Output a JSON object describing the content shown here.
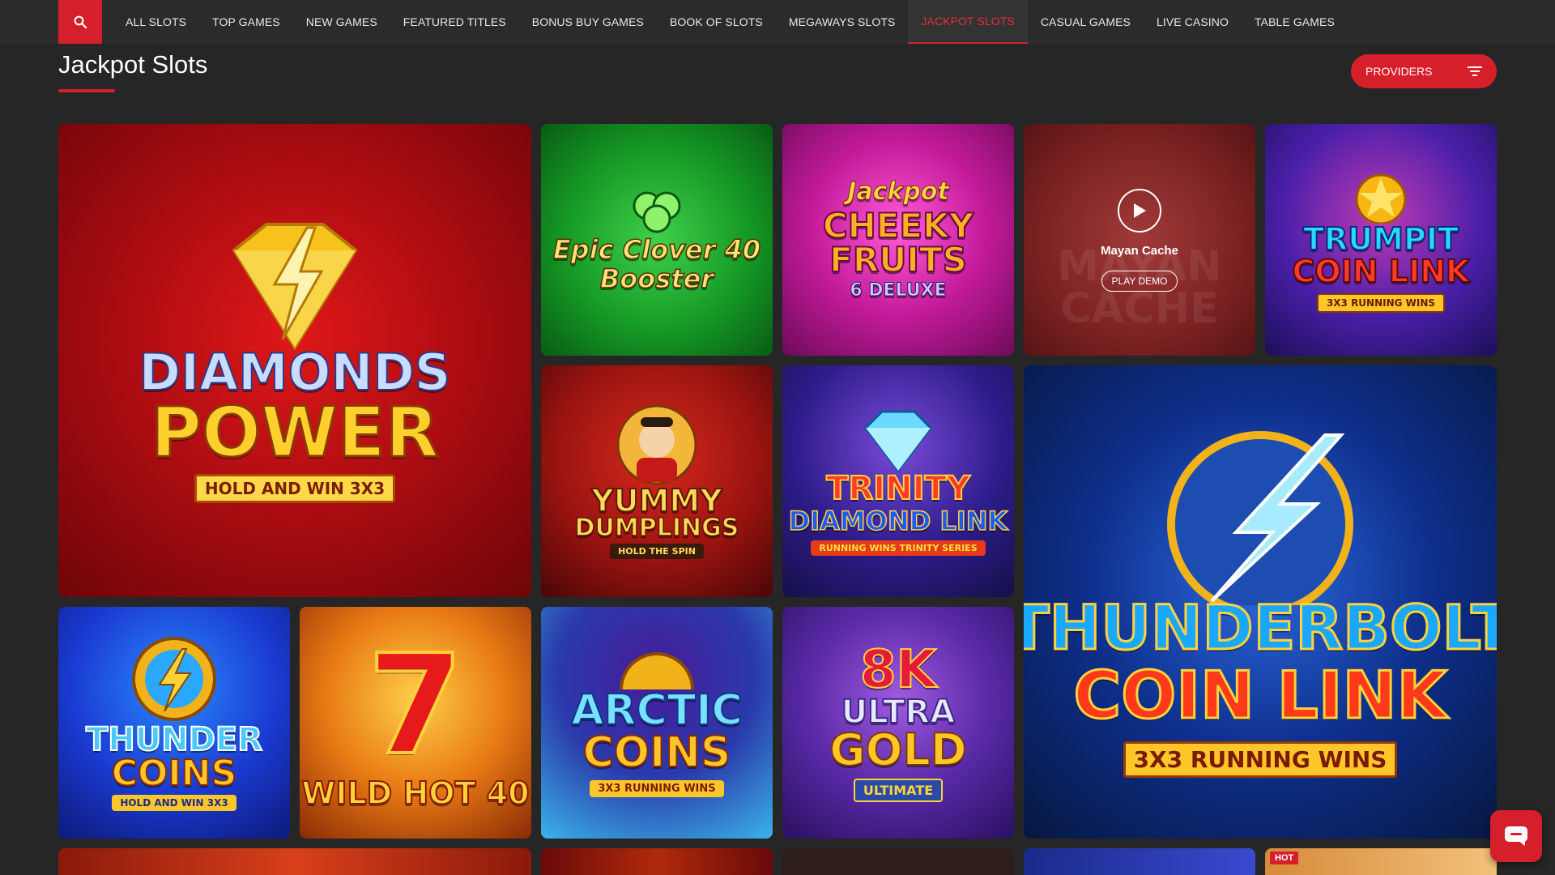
{
  "nav": {
    "items": [
      {
        "label": "ALL SLOTS"
      },
      {
        "label": "TOP GAMES"
      },
      {
        "label": "NEW GAMES"
      },
      {
        "label": "FEATURED TITLES"
      },
      {
        "label": "BONUS BUY GAMES"
      },
      {
        "label": "BOOK OF SLOTS"
      },
      {
        "label": "MEGAWAYS SLOTS"
      },
      {
        "label": "JACKPOT SLOTS"
      },
      {
        "label": "CASUAL GAMES"
      },
      {
        "label": "LIVE CASINO"
      },
      {
        "label": "TABLE GAMES"
      }
    ],
    "active_index": 7,
    "search_icon": "search-icon"
  },
  "page": {
    "title": "Jackpot Slots",
    "providers_label": "PROVIDERS",
    "filter_icon": "filter-icon"
  },
  "colors": {
    "accent": "#d51f2a",
    "background": "#262626",
    "nav_background": "#2b2b2b"
  },
  "games": {
    "diamonds_power": {
      "line1": "DIAMONDS",
      "line2": "POWER",
      "line3": "HOLD AND WIN 3X3"
    },
    "epic_clover": {
      "line1": "Epic Clover 40",
      "line2": "Booster"
    },
    "cheeky_fruits": {
      "line0": "Jackpot",
      "line1": "CHEEKY",
      "line2": "FRUITS",
      "line3": "6 DELUXE"
    },
    "mayan_cache": {
      "name": "Mayan Cache",
      "bg_text": "MAYAN CACHE",
      "demo_label": "PLAY DEMO",
      "play_icon": "play-icon"
    },
    "trumpit": {
      "line1": "TRUMPIT",
      "line2": "COIN LINK",
      "line3": "3X3 RUNNING WINS"
    },
    "yummy": {
      "line1": "YUMMY",
      "line2": "DUMPLINGS",
      "line3": "HOLD THE SPIN"
    },
    "trinity": {
      "line1": "TRINITY",
      "line2": "DIAMOND LINK",
      "line3": "RUNNING WINS TRINITY SERIES"
    },
    "thunderbolt": {
      "line1": "THUNDERBOLT",
      "line2": "COIN LINK",
      "line3": "3X3 RUNNING WINS"
    },
    "thunder_coins": {
      "line1": "THUNDER",
      "line2": "COINS",
      "line3": "HOLD AND WIN 3X3"
    },
    "wild_hot": {
      "line1": "7",
      "line2": "WILD HOT 40"
    },
    "arctic": {
      "line1": "ARCTIC",
      "line2": "COINS",
      "line3": "3X3 RUNNING WINS"
    },
    "ultra_gold": {
      "line1": "8K",
      "line2": "ULTRA",
      "line3": "GOLD",
      "line4": "ULTIMATE"
    }
  },
  "bottom_row": {
    "hot_badge": "HOT"
  },
  "chat": {
    "icon": "chat-icon"
  }
}
